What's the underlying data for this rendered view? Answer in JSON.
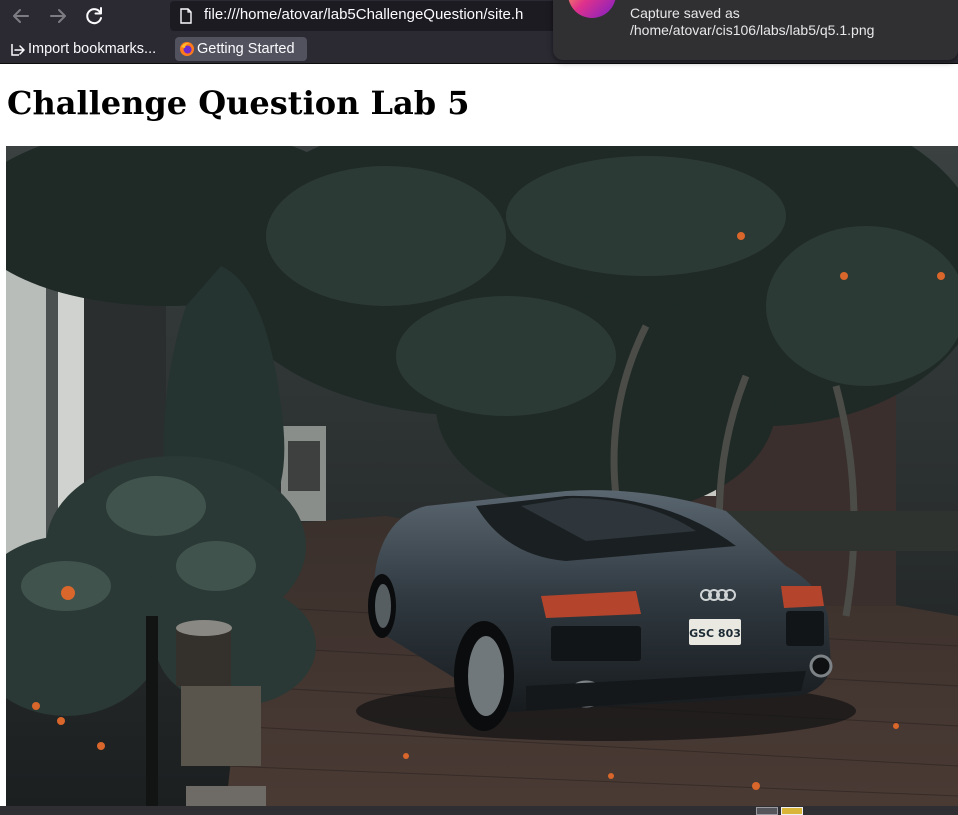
{
  "browser": {
    "url": "file:///home/atovar/lab5ChallengeQuestion/site.h",
    "bookmarks": [
      {
        "label": "Import bookmarks..."
      },
      {
        "label": "Getting Started"
      }
    ]
  },
  "notification": {
    "message": "Capture saved as /home/atovar/cis106/labs/lab5/q5.1.png"
  },
  "page": {
    "heading": "Challenge Question Lab 5"
  },
  "photo": {
    "license_plate": "GSC 803"
  },
  "colors": {
    "chrome_bg": "#2b2a33",
    "urlbar_bg": "#1c1b22",
    "notification_bg": "#303033",
    "page_bg": "#ffffff"
  }
}
